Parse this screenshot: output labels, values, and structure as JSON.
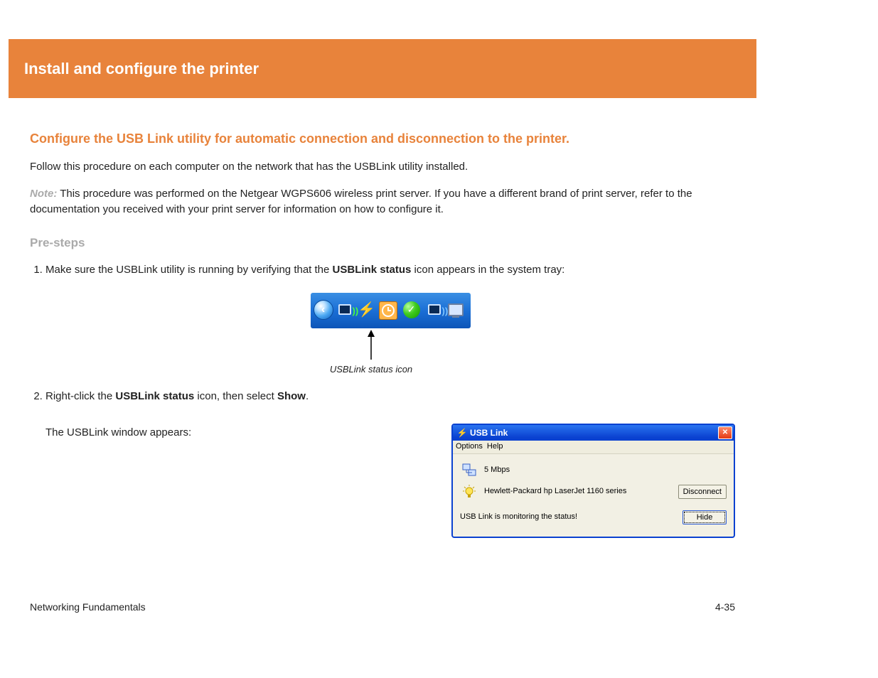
{
  "banner": {
    "title": "Install and configure the printer"
  },
  "intro": {
    "heading": "Configure the USB Link utility for automatic connection and disconnection to the printer.",
    "p1": "Follow this procedure on each computer on the network that has the USBLink utility installed.",
    "note_prefix": "Note:",
    "note_body": " This procedure was performed on the Netgear WGPS606 wireless print server. If you have a different brand of print server, refer to the documentation you received with your print server for information on how to configure it."
  },
  "steps": {
    "heading": "Pre-steps",
    "item1_pre": "Make sure the USBLink utility is running by verifying that the ",
    "item1_mid": "USBLink status",
    "item1_post": " icon appears in the system tray:",
    "tray_caption": "USBLink status icon",
    "item2_pre": "Right-click the ",
    "item2_mid": "USBLink status",
    "item2_post": " icon, then select ",
    "item2_end": "Show"
  },
  "window_note": "The USBLink window appears:",
  "usb_window": {
    "title": "USB Link",
    "menu_options": "Options",
    "menu_help": "Help",
    "speed": "5 Mbps",
    "device": "Hewlett-Packard hp LaserJet 1160 series",
    "status": "USB Link is monitoring the status!",
    "disconnect": "Disconnect",
    "hide": "Hide"
  },
  "footer": {
    "left": "Networking Fundamentals",
    "right": "4-35"
  }
}
